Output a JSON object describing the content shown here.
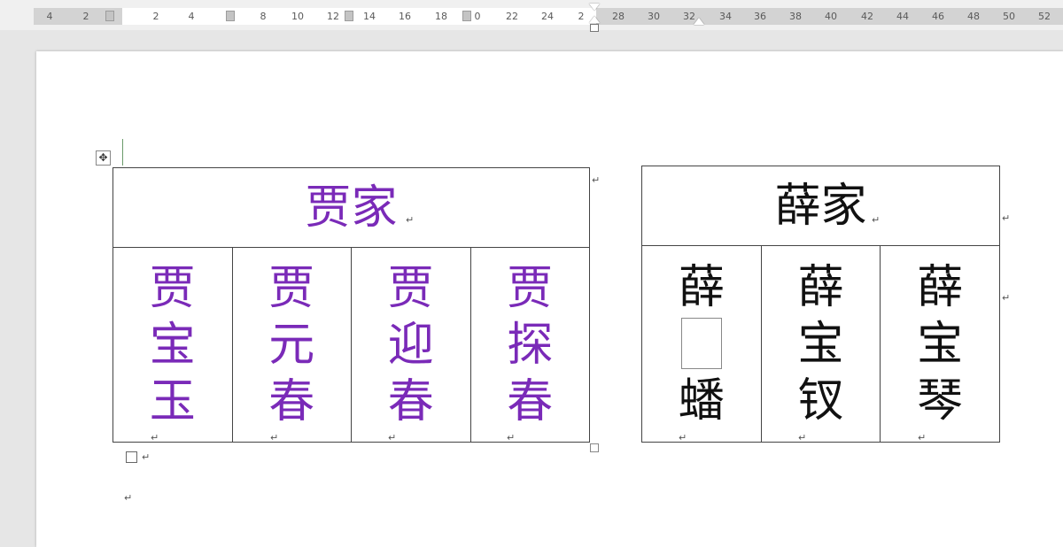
{
  "ruler": {
    "ticks": [
      "4",
      "2",
      "2",
      "4",
      "8",
      "10",
      "12",
      "14",
      "16",
      "18",
      "0",
      "22",
      "24",
      "2",
      "28",
      "30",
      "32",
      "34",
      "36",
      "38",
      "40",
      "42",
      "44",
      "46",
      "48",
      "50",
      "52"
    ]
  },
  "icons": {
    "move_handle": "four-arrow-move-icon",
    "paragraph_mark": "↵"
  },
  "jia_table": {
    "header": "贾家",
    "members": [
      [
        "贾",
        "宝",
        "玉"
      ],
      [
        "贾",
        "元",
        "春"
      ],
      [
        "贾",
        "迎",
        "春"
      ],
      [
        "贾",
        "探",
        "春"
      ]
    ],
    "color": "#7a2ab8"
  },
  "xue_table": {
    "header": "薛家",
    "members": [
      [
        "薛",
        "",
        "蟠"
      ],
      [
        "薛",
        "宝",
        "钗"
      ],
      [
        "薛",
        "宝",
        "琴"
      ]
    ],
    "color": "#111111"
  }
}
